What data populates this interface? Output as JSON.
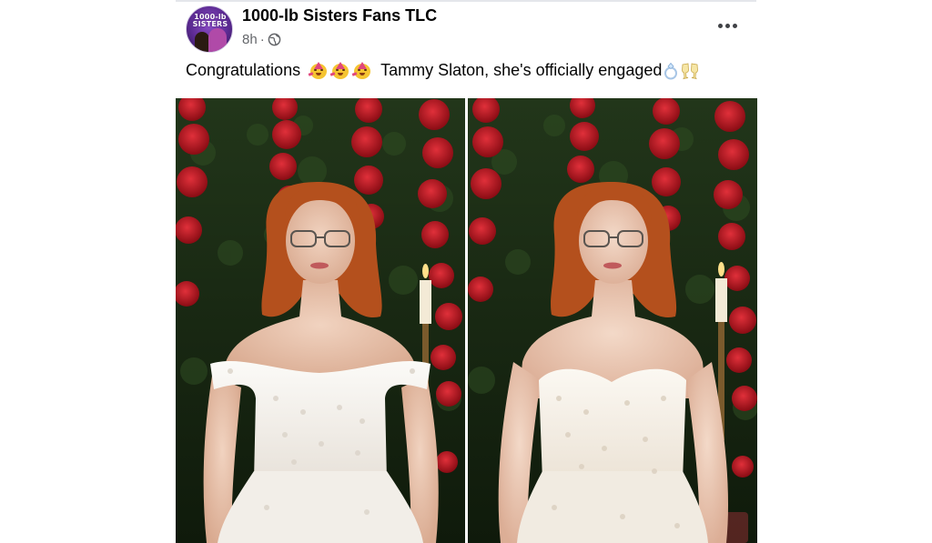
{
  "post": {
    "page_name": "1000-lb Sisters Fans TLC",
    "time": "8h",
    "separator": "·",
    "avatar_text": [
      "1000-lb",
      "SISTERS"
    ],
    "text_before_emojis": "Congratulations",
    "text_after_emojis": "Tammy Slaton, she's officially engaged",
    "emojis": [
      "partying-face-emoji",
      "partying-face-emoji",
      "partying-face-emoji",
      "ring-emoji",
      "clinking-glasses-emoji"
    ],
    "photo_count": 2
  },
  "icons": {
    "audience": "globe-icon",
    "menu": "more-dots-icon"
  },
  "colors": {
    "name_text": "#050505",
    "meta_text": "#65676b",
    "avatar_bg": "#5b2a92",
    "roses": "#b3131b",
    "foliage": "#1e3a15",
    "hair": "#b4501d",
    "dress": "#f4f0ea"
  }
}
